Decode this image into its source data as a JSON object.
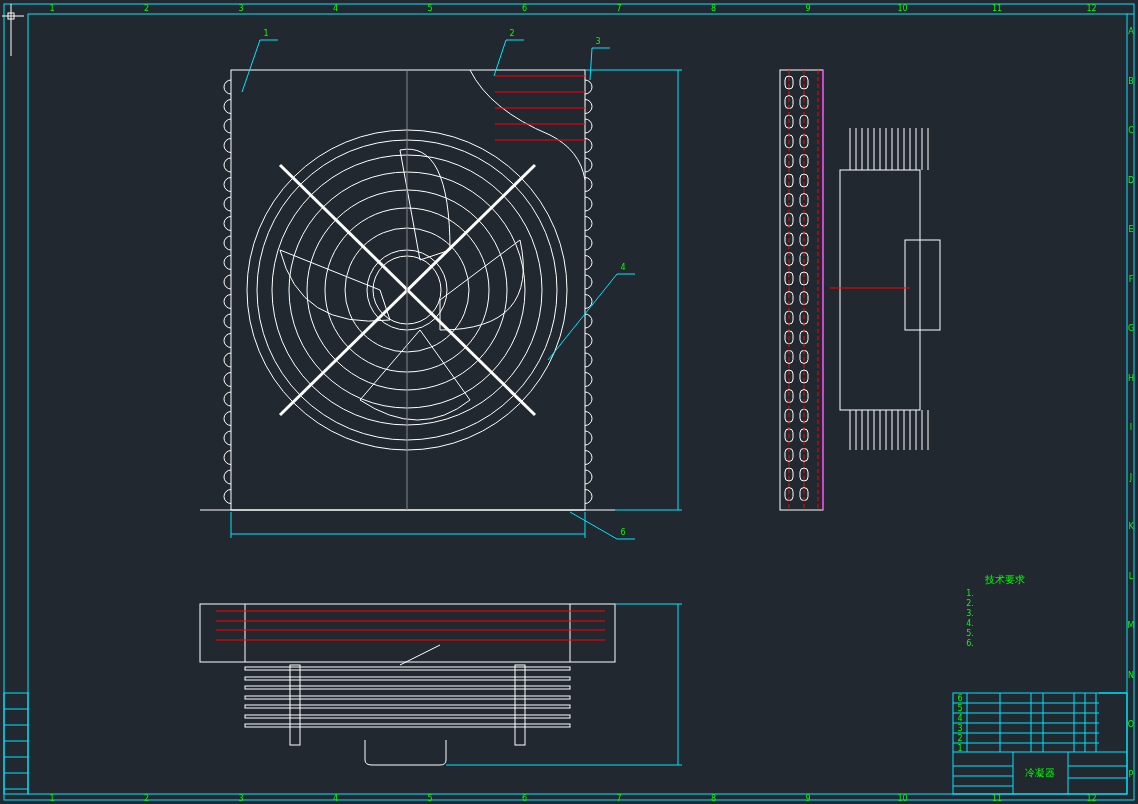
{
  "frame": {
    "column_labels": [
      "1",
      "2",
      "3",
      "4",
      "5",
      "6",
      "7",
      "8",
      "9",
      "10",
      "11",
      "12"
    ],
    "bottom_column_labels": [
      "1",
      "2",
      "3",
      "4",
      "5",
      "6",
      "7",
      "8",
      "9",
      "10",
      "11",
      "12"
    ],
    "row_labels": [
      "A",
      "B",
      "C",
      "D",
      "E",
      "F",
      "G",
      "H",
      "I",
      "J",
      "K",
      "L",
      "M",
      "N",
      "O",
      "P"
    ]
  },
  "balloons": [
    {
      "number": "1"
    },
    {
      "number": "2"
    },
    {
      "number": "3"
    },
    {
      "number": "4"
    },
    {
      "number": "6"
    }
  ],
  "notes": {
    "heading": "技术要求",
    "items": [
      "1.",
      "2.",
      "3.",
      "4.",
      "5.",
      "6."
    ]
  },
  "parts_list": [
    {
      "no": "6"
    },
    {
      "no": "5"
    },
    {
      "no": "4"
    },
    {
      "no": "3"
    },
    {
      "no": "2"
    },
    {
      "no": "1"
    }
  ],
  "title_block": {
    "title": "冷凝器"
  }
}
